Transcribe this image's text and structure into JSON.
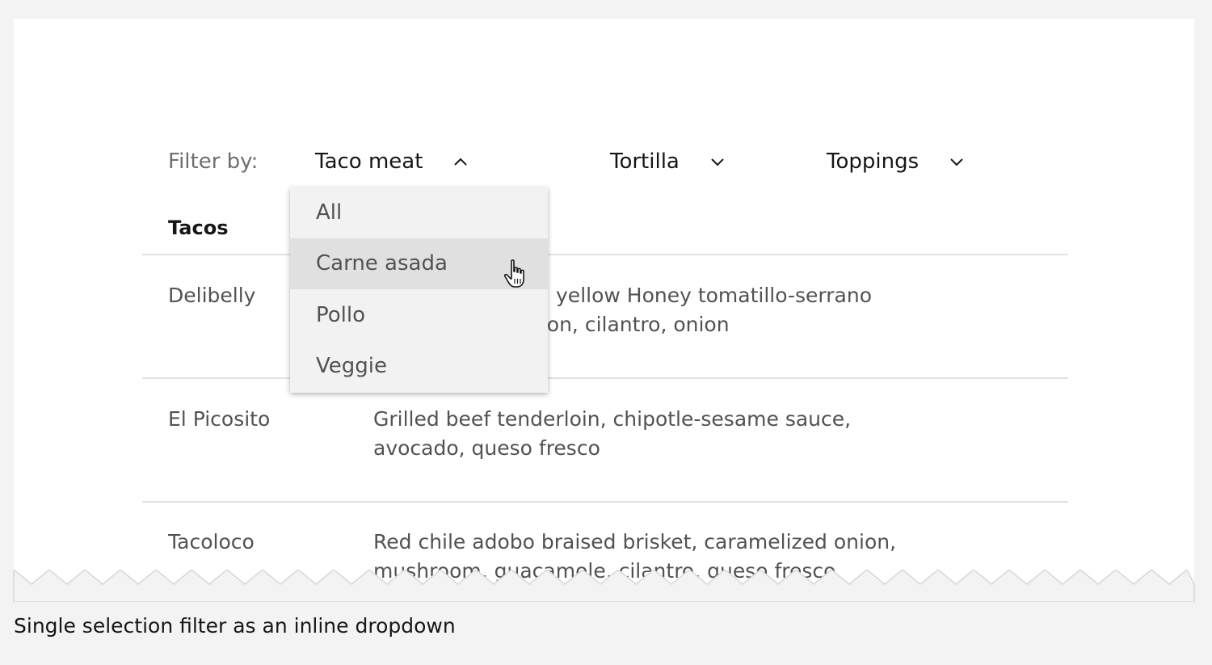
{
  "filters": {
    "label": "Filter by:",
    "items": [
      {
        "label": "Taco meat",
        "open": true
      },
      {
        "label": "Tortilla",
        "open": false
      },
      {
        "label": "Toppings",
        "open": false
      }
    ]
  },
  "dropdown": {
    "options": [
      "All",
      "Carne asada",
      "Pollo",
      "Veggie"
    ],
    "hovered": "Carne asada"
  },
  "table": {
    "header": "Tacos",
    "rows": [
      {
        "name": "Delibelly",
        "desc_lines": [
          "Crispy pork belly, yellow Honey tomatillo-serrano",
          "salsa, pickled onion, cilantro, onion"
        ]
      },
      {
        "name": "El Picosito",
        "desc_lines": [
          "Grilled beef tenderloin, chipotle-sesame sauce,",
          "avocado, queso fresco"
        ]
      },
      {
        "name": "Tacoloco",
        "desc_lines": [
          "Red chile adobo braised brisket, caramelized onion,",
          "mushroom, guacamole, cilantro, queso fresco"
        ]
      }
    ]
  },
  "caption": "Single selection filter as an inline dropdown"
}
